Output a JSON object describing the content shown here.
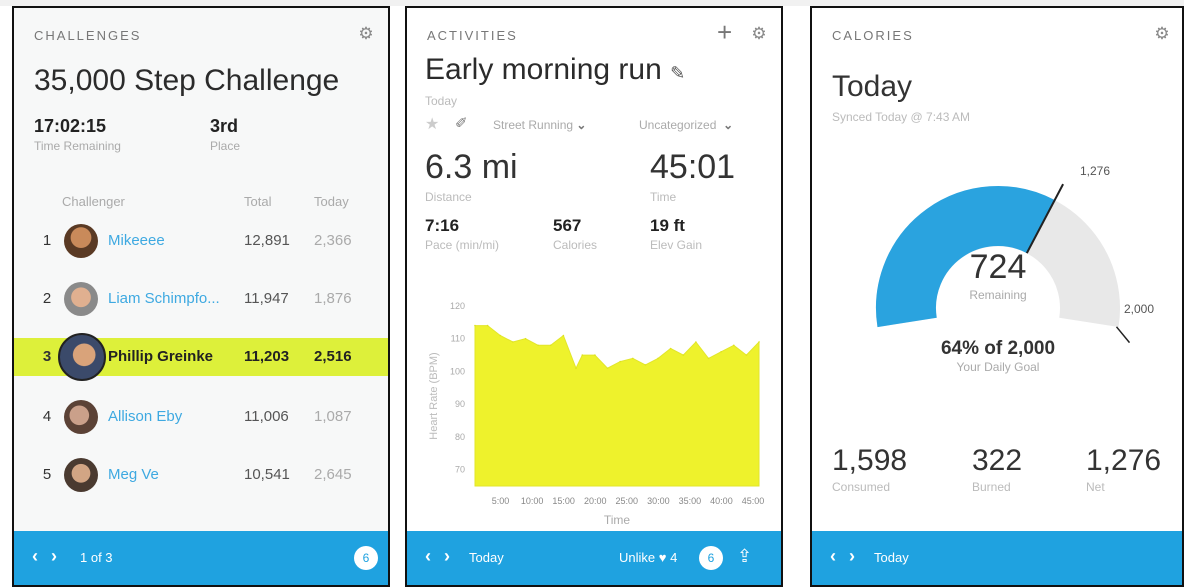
{
  "challenges": {
    "header": "CHALLENGES",
    "title": "35,000 Step Challenge",
    "time_remaining": {
      "value": "17:02:15",
      "label": "Time Remaining"
    },
    "place": {
      "value": "3rd",
      "label": "Place"
    },
    "columns": {
      "challenger": "Challenger",
      "total": "Total",
      "today": "Today"
    },
    "rows": [
      {
        "rank": "1",
        "name": "Mikeeee",
        "total": "12,891",
        "today": "2,366",
        "highlight": false
      },
      {
        "rank": "2",
        "name": "Liam Schimpfo...",
        "total": "11,947",
        "today": "1,876",
        "highlight": false
      },
      {
        "rank": "3",
        "name": "Phillip Greinke",
        "total": "11,203",
        "today": "2,516",
        "highlight": true
      },
      {
        "rank": "4",
        "name": "Allison Eby",
        "total": "11,006",
        "today": "1,087",
        "highlight": false
      },
      {
        "rank": "5",
        "name": "Meg Ve",
        "total": "10,541",
        "today": "2,645",
        "highlight": false
      }
    ],
    "footer": {
      "page": "1 of 3",
      "badge": "6"
    }
  },
  "activities": {
    "header": "ACTIVITIES",
    "title": "Early morning run",
    "date": "Today",
    "type_select": "Street Running",
    "category_select": "Uncategorized",
    "distance": {
      "value": "6.3 mi",
      "label": "Distance"
    },
    "time": {
      "value": "45:01",
      "label": "Time"
    },
    "pace": {
      "value": "7:16",
      "label": "Pace (min/mi)"
    },
    "calories": {
      "value": "567",
      "label": "Calories"
    },
    "elev": {
      "value": "19 ft",
      "label": "Elev Gain"
    },
    "footer": {
      "nav": "Today",
      "unlike": "Unlike ♥ 4",
      "badge": "6"
    }
  },
  "calories": {
    "header": "CALORIES",
    "title": "Today",
    "synced": "Synced Today @ 7:43 AM",
    "gauge": {
      "fraction_consumed": 0.64,
      "marker_label": "1,276",
      "max_label": "2,000"
    },
    "remaining": {
      "value": "724",
      "label": "Remaining"
    },
    "goal": {
      "pct": "64%",
      "of": " of 2,000",
      "label": "Your Daily Goal"
    },
    "consumed": {
      "value": "1,598",
      "label": "Consumed"
    },
    "burned": {
      "value": "322",
      "label": "Burned"
    },
    "net": {
      "value": "1,276",
      "label": "Net"
    },
    "footer": {
      "nav": "Today"
    }
  },
  "chart_data": {
    "type": "area",
    "ylabel": "Heart Rate (BPM)",
    "xlabel": "Time",
    "ylim": [
      65,
      120
    ],
    "yticks": [
      "120",
      "110",
      "100",
      "90",
      "80",
      "70"
    ],
    "xticks": [
      "5:00",
      "10:00",
      "15:00",
      "20:00",
      "25:00",
      "30:00",
      "35:00",
      "40:00",
      "45:00"
    ],
    "x": [
      0,
      2,
      4,
      6,
      8,
      10,
      12,
      14,
      16,
      17,
      19,
      21,
      23,
      25,
      27,
      29,
      31,
      33,
      35,
      37,
      39,
      41,
      43,
      45
    ],
    "values": [
      114,
      114,
      111,
      109,
      110,
      108,
      108,
      111,
      101,
      105,
      105,
      101,
      103,
      104,
      102,
      104,
      107,
      105,
      109,
      104,
      106,
      108,
      105,
      109
    ],
    "fill_color": "#eef22c"
  },
  "colors": {
    "accent": "#1fa2e0",
    "highlight": "#ddf03a",
    "gauge_fill": "#2aa3df",
    "gauge_track": "#e8e8e8"
  }
}
